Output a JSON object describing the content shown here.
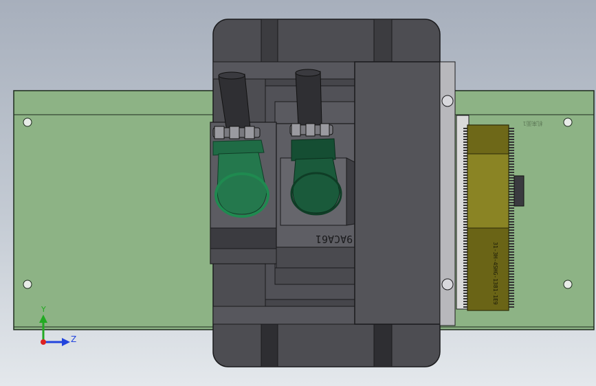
{
  "viewport": {
    "background_top": "#a7afbc",
    "background_bottom": "#e4e8ec"
  },
  "colors": {
    "base_plate": "#8db385",
    "base_plate_edge": "#1d2a1d",
    "housing_dark": "#4a4a4f",
    "housing_mid": "#58585e",
    "housing_light": "#6b6b72",
    "hose_black": "#2f2f33",
    "fitting_green": "#1f6b45",
    "fitting_green_dark": "#0f3d26",
    "gear_olive": "#6e6818",
    "gear_olive_light": "#8a8424",
    "axis_y": "#22aa22",
    "axis_z": "#2244dd",
    "axis_origin": "#dd2222"
  },
  "part_marking": "9ACA61",
  "gear_marking": "31-3H-4SHG-1381-1E9",
  "plate_marking": "机来面1",
  "axis_labels": {
    "y": "Y",
    "z": "Z"
  },
  "icons": {
    "triad": "coordinate-triad-icon"
  }
}
